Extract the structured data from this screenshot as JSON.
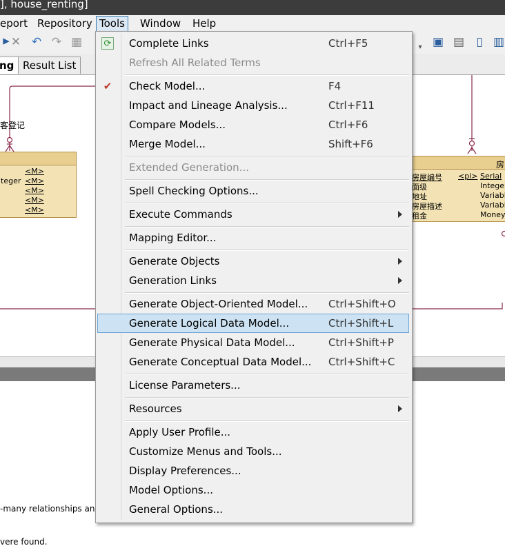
{
  "window": {
    "title": "], house_renting]"
  },
  "menubar": {
    "items": [
      {
        "label": "eport"
      },
      {
        "label": "Repository"
      },
      {
        "label": "Tools"
      },
      {
        "label": "Window"
      },
      {
        "label": "Help"
      }
    ]
  },
  "tabs": {
    "left_tab": "ng",
    "result_tab": "Result List"
  },
  "canvas": {
    "left_label": "客登记",
    "left_entity_rows": [
      {
        "type": "",
        "tag": "<M>"
      },
      {
        "type": "teger",
        "tag": "<M>"
      },
      {
        "type": "",
        "tag": "<M>"
      },
      {
        "type": "",
        "tag": "<M>"
      },
      {
        "type": "",
        "tag": "<M>"
      }
    ],
    "right_entity_title": "房",
    "right_entity_rows": [
      {
        "name": "房屋编号",
        "key": "<pi>",
        "type": "Serial"
      },
      {
        "name": "面级",
        "key": "",
        "type": "Integer"
      },
      {
        "name": "地址",
        "key": "",
        "type": "Variabl"
      },
      {
        "name": "房屋描述",
        "key": "",
        "type": "Variabl"
      },
      {
        "name": "租金",
        "key": "",
        "type": "Money"
      }
    ]
  },
  "output": {
    "line1": "-many relationships and",
    "line2": "vere found."
  },
  "dropdown": {
    "items": [
      {
        "label": "Complete Links",
        "shortcut": "Ctrl+F5",
        "icon": "refresh-icon"
      },
      {
        "label": "Refresh All Related Terms",
        "shortcut": "",
        "disabled": true
      },
      {
        "label": "Check Model...",
        "shortcut": "F4",
        "icon": "check-model-icon"
      },
      {
        "label": "Impact and Lineage Analysis...",
        "shortcut": "Ctrl+F11"
      },
      {
        "label": "Compare Models...",
        "shortcut": "Ctrl+F6"
      },
      {
        "label": "Merge Model...",
        "shortcut": "Shift+F6"
      },
      {
        "label": "Extended Generation...",
        "shortcut": "",
        "disabled": true
      },
      {
        "label": "Spell Checking Options...",
        "shortcut": ""
      },
      {
        "label": "Execute Commands",
        "shortcut": "",
        "submenu": true
      },
      {
        "label": "Mapping Editor...",
        "shortcut": ""
      },
      {
        "label": "Generate Objects",
        "shortcut": "",
        "submenu": true
      },
      {
        "label": "Generation Links",
        "shortcut": "",
        "submenu": true
      },
      {
        "label": "Generate Object-Oriented Model...",
        "shortcut": "Ctrl+Shift+O"
      },
      {
        "label": "Generate Logical Data Model...",
        "shortcut": "Ctrl+Shift+L",
        "highlighted": true
      },
      {
        "label": "Generate Physical Data Model...",
        "shortcut": "Ctrl+Shift+P"
      },
      {
        "label": "Generate Conceptual Data Model...",
        "shortcut": "Ctrl+Shift+C"
      },
      {
        "label": "License Parameters...",
        "shortcut": ""
      },
      {
        "label": "Resources",
        "shortcut": "",
        "submenu": true
      },
      {
        "label": "Apply User Profile...",
        "shortcut": ""
      },
      {
        "label": "Customize Menus and Tools...",
        "shortcut": ""
      },
      {
        "label": "Display Preferences...",
        "shortcut": ""
      },
      {
        "label": "Model Options...",
        "shortcut": ""
      },
      {
        "label": "General Options...",
        "shortcut": ""
      }
    ]
  },
  "colors": {
    "highlight": "#cde3f3",
    "entity_fill": "#f3e3b4",
    "relationship_line": "#8a2a4a"
  }
}
